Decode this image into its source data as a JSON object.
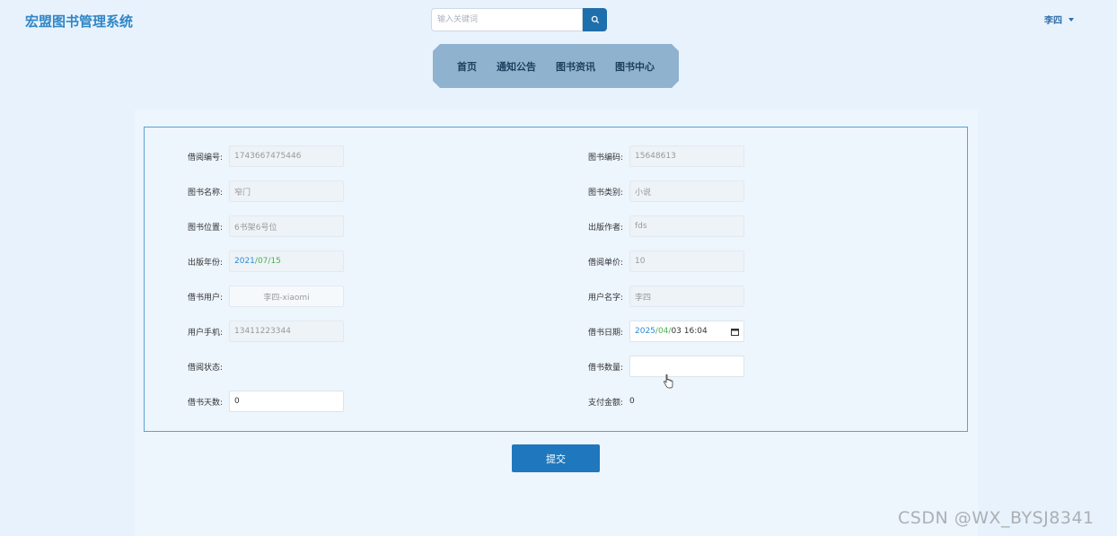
{
  "header": {
    "brand": "宏盟图书管理系统",
    "search_placeholder": "输入关键词",
    "user_name": "李四"
  },
  "nav": [
    "首页",
    "通知公告",
    "图书资讯",
    "图书中心"
  ],
  "form": {
    "borrow_no_label": "借阅编号:",
    "borrow_no": "1743667475446",
    "book_code_label": "图书编码:",
    "book_code": "15648613",
    "book_name_label": "图书名称:",
    "book_name": "窄门",
    "book_type_label": "图书类别:",
    "book_type": "小说",
    "book_location_label": "图书位置:",
    "book_location": "6书架6号位",
    "author_label": "出版作者:",
    "author": "fds",
    "pub_year_label": "出版年份:",
    "pub_year_y": "2021",
    "pub_year_m": "/07/",
    "pub_year_d": "15",
    "price_label": "借阅单价:",
    "price": "10",
    "borrow_user_label": "借书用户:",
    "borrow_user": "李四-xiaomi",
    "user_name_label": "用户名字:",
    "user_name": "李四",
    "phone_label": "用户手机:",
    "phone": "13411223344",
    "borrow_date_label": "借书日期:",
    "borrow_date_y": "2025",
    "borrow_date_m": "/04/",
    "borrow_date_rest": "03 16:04",
    "status_label": "借阅状态:",
    "quantity_label": "借书数量:",
    "quantity": "",
    "days_label": "借书天数:",
    "days": "0",
    "amount_label": "支付金额:",
    "amount": "0"
  },
  "submit_label": "提交",
  "watermark": "CSDN @WX_BYSJ8341",
  "colors": {
    "accent": "#1f78bd",
    "brand": "#2f86c6",
    "nav_bg": "#8fb2cf",
    "page_bg": "#e8f2fc"
  }
}
